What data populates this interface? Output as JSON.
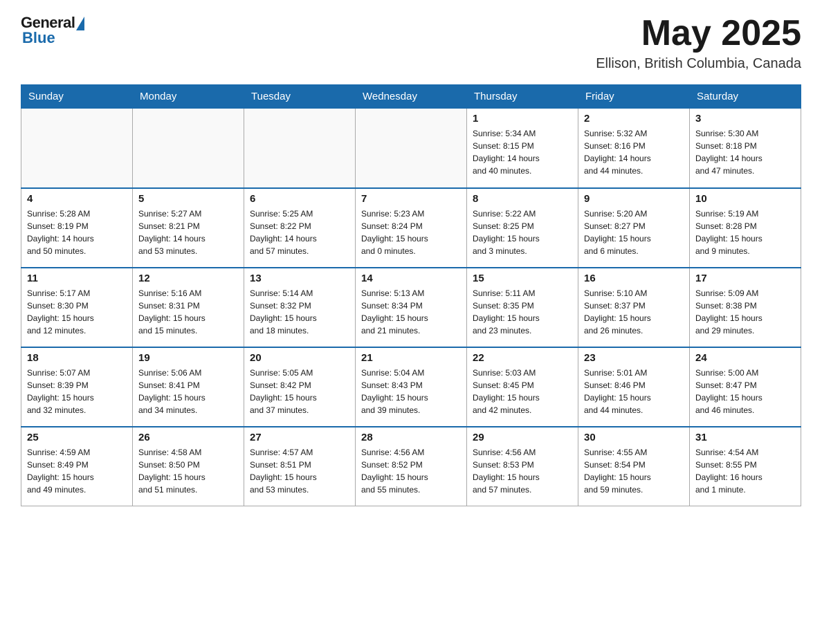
{
  "header": {
    "logo": {
      "general": "General",
      "blue": "Blue"
    },
    "title": "May 2025",
    "location": "Ellison, British Columbia, Canada"
  },
  "calendar": {
    "days_of_week": [
      "Sunday",
      "Monday",
      "Tuesday",
      "Wednesday",
      "Thursday",
      "Friday",
      "Saturday"
    ],
    "weeks": [
      [
        {
          "day": "",
          "info": ""
        },
        {
          "day": "",
          "info": ""
        },
        {
          "day": "",
          "info": ""
        },
        {
          "day": "",
          "info": ""
        },
        {
          "day": "1",
          "info": "Sunrise: 5:34 AM\nSunset: 8:15 PM\nDaylight: 14 hours\nand 40 minutes."
        },
        {
          "day": "2",
          "info": "Sunrise: 5:32 AM\nSunset: 8:16 PM\nDaylight: 14 hours\nand 44 minutes."
        },
        {
          "day": "3",
          "info": "Sunrise: 5:30 AM\nSunset: 8:18 PM\nDaylight: 14 hours\nand 47 minutes."
        }
      ],
      [
        {
          "day": "4",
          "info": "Sunrise: 5:28 AM\nSunset: 8:19 PM\nDaylight: 14 hours\nand 50 minutes."
        },
        {
          "day": "5",
          "info": "Sunrise: 5:27 AM\nSunset: 8:21 PM\nDaylight: 14 hours\nand 53 minutes."
        },
        {
          "day": "6",
          "info": "Sunrise: 5:25 AM\nSunset: 8:22 PM\nDaylight: 14 hours\nand 57 minutes."
        },
        {
          "day": "7",
          "info": "Sunrise: 5:23 AM\nSunset: 8:24 PM\nDaylight: 15 hours\nand 0 minutes."
        },
        {
          "day": "8",
          "info": "Sunrise: 5:22 AM\nSunset: 8:25 PM\nDaylight: 15 hours\nand 3 minutes."
        },
        {
          "day": "9",
          "info": "Sunrise: 5:20 AM\nSunset: 8:27 PM\nDaylight: 15 hours\nand 6 minutes."
        },
        {
          "day": "10",
          "info": "Sunrise: 5:19 AM\nSunset: 8:28 PM\nDaylight: 15 hours\nand 9 minutes."
        }
      ],
      [
        {
          "day": "11",
          "info": "Sunrise: 5:17 AM\nSunset: 8:30 PM\nDaylight: 15 hours\nand 12 minutes."
        },
        {
          "day": "12",
          "info": "Sunrise: 5:16 AM\nSunset: 8:31 PM\nDaylight: 15 hours\nand 15 minutes."
        },
        {
          "day": "13",
          "info": "Sunrise: 5:14 AM\nSunset: 8:32 PM\nDaylight: 15 hours\nand 18 minutes."
        },
        {
          "day": "14",
          "info": "Sunrise: 5:13 AM\nSunset: 8:34 PM\nDaylight: 15 hours\nand 21 minutes."
        },
        {
          "day": "15",
          "info": "Sunrise: 5:11 AM\nSunset: 8:35 PM\nDaylight: 15 hours\nand 23 minutes."
        },
        {
          "day": "16",
          "info": "Sunrise: 5:10 AM\nSunset: 8:37 PM\nDaylight: 15 hours\nand 26 minutes."
        },
        {
          "day": "17",
          "info": "Sunrise: 5:09 AM\nSunset: 8:38 PM\nDaylight: 15 hours\nand 29 minutes."
        }
      ],
      [
        {
          "day": "18",
          "info": "Sunrise: 5:07 AM\nSunset: 8:39 PM\nDaylight: 15 hours\nand 32 minutes."
        },
        {
          "day": "19",
          "info": "Sunrise: 5:06 AM\nSunset: 8:41 PM\nDaylight: 15 hours\nand 34 minutes."
        },
        {
          "day": "20",
          "info": "Sunrise: 5:05 AM\nSunset: 8:42 PM\nDaylight: 15 hours\nand 37 minutes."
        },
        {
          "day": "21",
          "info": "Sunrise: 5:04 AM\nSunset: 8:43 PM\nDaylight: 15 hours\nand 39 minutes."
        },
        {
          "day": "22",
          "info": "Sunrise: 5:03 AM\nSunset: 8:45 PM\nDaylight: 15 hours\nand 42 minutes."
        },
        {
          "day": "23",
          "info": "Sunrise: 5:01 AM\nSunset: 8:46 PM\nDaylight: 15 hours\nand 44 minutes."
        },
        {
          "day": "24",
          "info": "Sunrise: 5:00 AM\nSunset: 8:47 PM\nDaylight: 15 hours\nand 46 minutes."
        }
      ],
      [
        {
          "day": "25",
          "info": "Sunrise: 4:59 AM\nSunset: 8:49 PM\nDaylight: 15 hours\nand 49 minutes."
        },
        {
          "day": "26",
          "info": "Sunrise: 4:58 AM\nSunset: 8:50 PM\nDaylight: 15 hours\nand 51 minutes."
        },
        {
          "day": "27",
          "info": "Sunrise: 4:57 AM\nSunset: 8:51 PM\nDaylight: 15 hours\nand 53 minutes."
        },
        {
          "day": "28",
          "info": "Sunrise: 4:56 AM\nSunset: 8:52 PM\nDaylight: 15 hours\nand 55 minutes."
        },
        {
          "day": "29",
          "info": "Sunrise: 4:56 AM\nSunset: 8:53 PM\nDaylight: 15 hours\nand 57 minutes."
        },
        {
          "day": "30",
          "info": "Sunrise: 4:55 AM\nSunset: 8:54 PM\nDaylight: 15 hours\nand 59 minutes."
        },
        {
          "day": "31",
          "info": "Sunrise: 4:54 AM\nSunset: 8:55 PM\nDaylight: 16 hours\nand 1 minute."
        }
      ]
    ]
  }
}
